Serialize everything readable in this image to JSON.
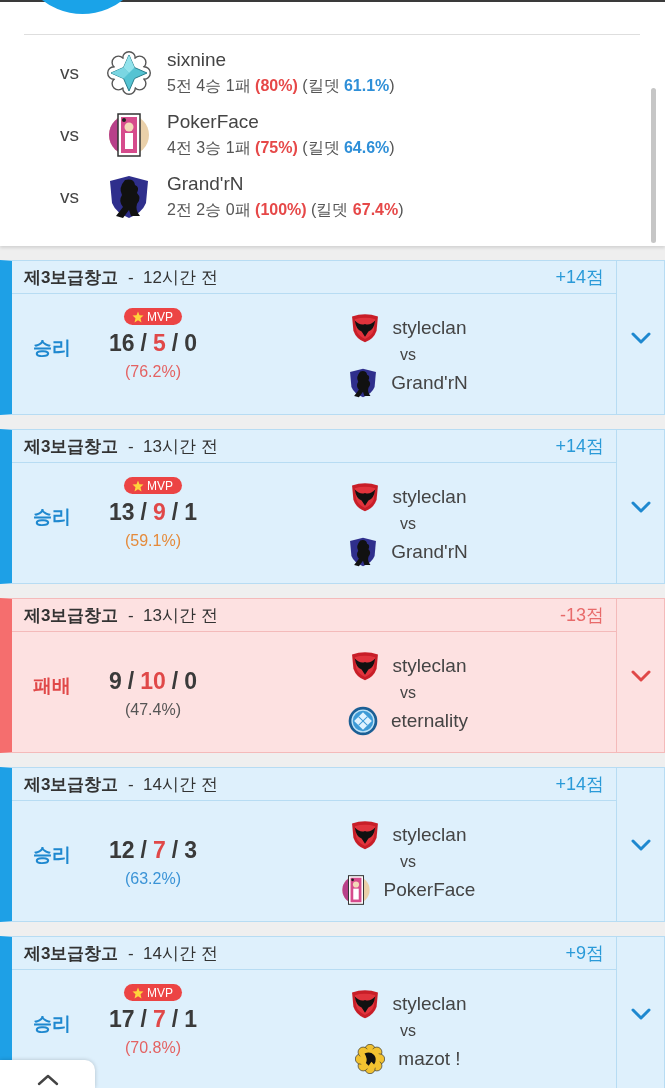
{
  "head_to_head": [
    {
      "vs": "vs",
      "team": {
        "name": "sixnine",
        "kind": "crystal"
      },
      "record": "5전 4승 1패",
      "win_rate": "(80%)",
      "kill_death": {
        "label": "(킬뎃",
        "value": "61.1%",
        "close": ")",
        "color": "#2e8fd8"
      }
    },
    {
      "vs": "vs",
      "team": {
        "name": "PokerFace",
        "kind": "card"
      },
      "record": "4전 3승 1패",
      "win_rate": "(75%)",
      "kill_death": {
        "label": "(킬뎃",
        "value": "64.6%",
        "close": ")",
        "color": "#2e8fd8"
      }
    },
    {
      "vs": "vs",
      "team": {
        "name": "Grand'rN",
        "kind": "shield"
      },
      "record": "2전 2승 0패",
      "win_rate": "(100%)",
      "kill_death": {
        "label": "(킬뎃",
        "value": "67.4%",
        "close": ")",
        "color": "#e64848"
      }
    }
  ],
  "matches": [
    {
      "kind": "win",
      "title": "**제3보급창고**  -  12시간 전",
      "points": "+14점",
      "result": "승리",
      "mvp": true,
      "mvp_label": "MVP",
      "kda": [
        {
          "kind": "kills",
          "value": "16"
        },
        {
          "kind": "separator",
          "value": "/"
        },
        {
          "kind": "deaths",
          "value": "5"
        },
        {
          "kind": "separator",
          "value": "/"
        },
        {
          "kind": "assists",
          "value": "0"
        }
      ],
      "ratio": {
        "text": "(76.2%)",
        "color": "#e46262"
      },
      "teams": [
        {
          "name": "styleclan",
          "kind": "phoenix"
        },
        {
          "name": "Grand'rN",
          "kind": "shield"
        }
      ],
      "vs": "vs"
    },
    {
      "kind": "win",
      "title": "**제3보급창고**  -  13시간 전",
      "points": "+14점",
      "result": "승리",
      "mvp": true,
      "mvp_label": "MVP",
      "kda": [
        {
          "kind": "kills",
          "value": "13"
        },
        {
          "kind": "separator",
          "value": "/"
        },
        {
          "kind": "deaths",
          "value": "9"
        },
        {
          "kind": "separator",
          "value": "/"
        },
        {
          "kind": "assists",
          "value": "1"
        }
      ],
      "ratio": {
        "text": "(59.1%)",
        "color": "#e58a3a"
      },
      "teams": [
        {
          "name": "styleclan",
          "kind": "phoenix"
        },
        {
          "name": "Grand'rN",
          "kind": "shield"
        }
      ],
      "vs": "vs"
    },
    {
      "kind": "loss",
      "title": "**제3보급창고**  -  13시간 전",
      "points": "-13점",
      "result": "패배",
      "mvp": false,
      "kda": [
        {
          "kind": "kills",
          "value": "9"
        },
        {
          "kind": "separator",
          "value": "/"
        },
        {
          "kind": "deaths",
          "value": "10"
        },
        {
          "kind": "separator",
          "value": "/"
        },
        {
          "kind": "assists",
          "value": "0"
        }
      ],
      "ratio": {
        "text": "(47.4%)",
        "color": "#555555"
      },
      "teams": [
        {
          "name": "styleclan",
          "kind": "phoenix"
        },
        {
          "name": "eternality",
          "kind": "orb"
        }
      ],
      "vs": "vs"
    },
    {
      "kind": "win",
      "title": "**제3보급창고**  -  14시간 전",
      "points": "+14점",
      "result": "승리",
      "mvp": false,
      "kda": [
        {
          "kind": "kills",
          "value": "12"
        },
        {
          "kind": "separator",
          "value": "/"
        },
        {
          "kind": "deaths",
          "value": "7"
        },
        {
          "kind": "separator",
          "value": "/"
        },
        {
          "kind": "assists",
          "value": "3"
        }
      ],
      "ratio": {
        "text": "(63.2%)",
        "color": "#3a93d6"
      },
      "teams": [
        {
          "name": "styleclan",
          "kind": "phoenix"
        },
        {
          "name": "PokerFace",
          "kind": "card"
        }
      ],
      "vs": "vs"
    },
    {
      "kind": "win",
      "title": "**제3보급창고**  -  14시간 전",
      "points": "+9점",
      "result": "승리",
      "mvp": true,
      "mvp_label": "MVP",
      "kda": [
        {
          "kind": "kills",
          "value": "17"
        },
        {
          "kind": "separator",
          "value": "/"
        },
        {
          "kind": "deaths",
          "value": "7"
        },
        {
          "kind": "separator",
          "value": "/"
        },
        {
          "kind": "assists",
          "value": "1"
        }
      ],
      "ratio": {
        "text": "(70.8%)",
        "color": "#e46262"
      },
      "teams": [
        {
          "name": "styleclan",
          "kind": "phoenix"
        },
        {
          "name": "mazot !",
          "kind": "flower"
        }
      ],
      "vs": "vs"
    }
  ]
}
